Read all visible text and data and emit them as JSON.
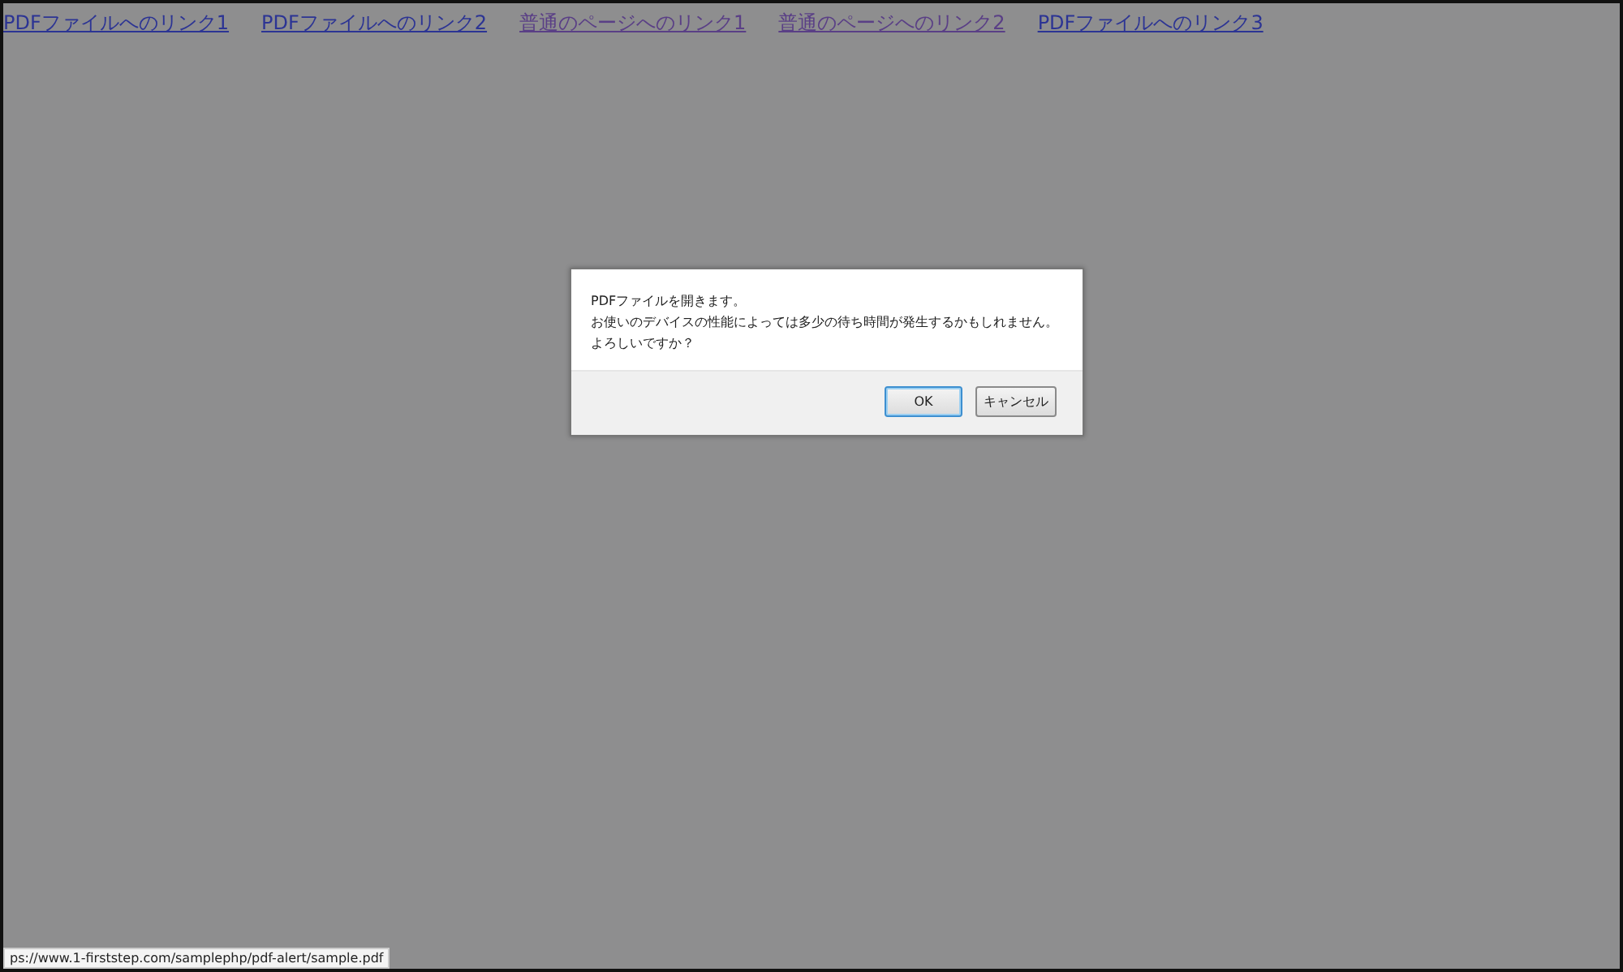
{
  "links": [
    {
      "label": "PDFファイルへのリンク1",
      "visited": false
    },
    {
      "label": "PDFファイルへのリンク2",
      "visited": false
    },
    {
      "label": "普通のページへのリンク1",
      "visited": true
    },
    {
      "label": "普通のページへのリンク2",
      "visited": true
    },
    {
      "label": "PDFファイルへのリンク3",
      "visited": false
    }
  ],
  "dialog": {
    "message_lines": [
      "PDFファイルを開きます。",
      "お使いのデバイスの性能によっては多少の待ち時間が発生するかもしれません。",
      "よろしいですか？"
    ],
    "buttons": [
      {
        "label": "OK",
        "focused": true
      },
      {
        "label": "キャンセル",
        "focused": false
      }
    ]
  },
  "status_bar": "ps://www.1-firststep.com/samplephp/pdf-alert/sample.pdf"
}
